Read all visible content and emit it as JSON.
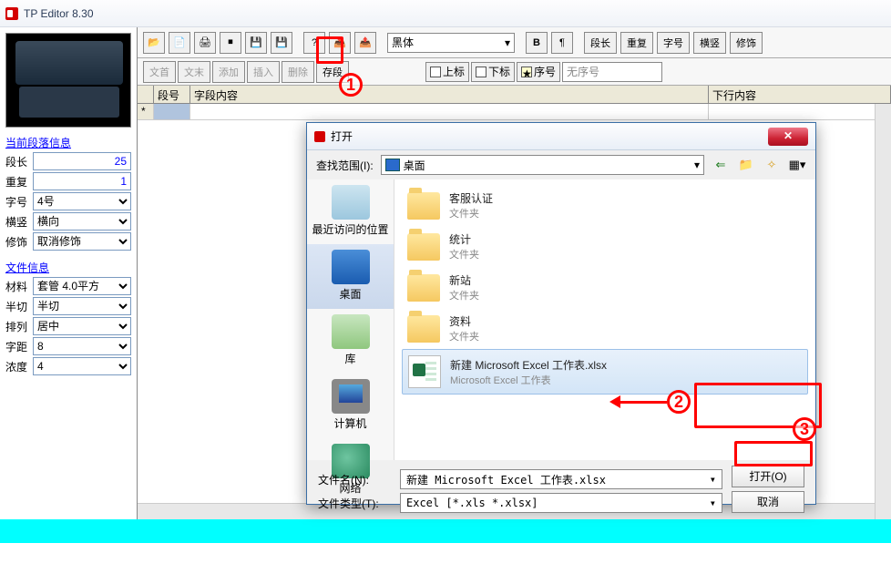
{
  "app": {
    "title": "TP Editor  8.30"
  },
  "left": {
    "section1": "当前段落信息",
    "duanchang_lbl": "段长",
    "duanchang_val": "25",
    "chongfu_lbl": "重复",
    "chongfu_val": "1",
    "zihao_lbl": "字号",
    "zihao_val": "4号",
    "hengshu_lbl": "横竖",
    "hengshu_val": "横向",
    "xiushi_lbl": "修饰",
    "xiushi_val": "取消修饰",
    "section2": "文件信息",
    "cailiao_lbl": "材料",
    "cailiao_val": "套管 4.0平方",
    "banqie_lbl": "半切",
    "banqie_val": "半切",
    "pailie_lbl": "排列",
    "pailie_val": "居中",
    "ziju_lbl": "字距",
    "ziju_val": "8",
    "nongdu_lbl": "浓度",
    "nongdu_val": "4"
  },
  "toolbar": {
    "font": "黑体",
    "btns2": [
      "文首",
      "文末",
      "添加",
      "插入",
      "删除",
      "存段"
    ],
    "btns_right": [
      "段长",
      "重复",
      "字号",
      "横竖",
      "修饰"
    ],
    "sup": "上标",
    "sub": "下标",
    "seq": "序号",
    "noindex": "无序号"
  },
  "grid": {
    "col1": "段号",
    "col2": "字段内容",
    "col3": "下行内容",
    "row_marker": "*"
  },
  "dialog": {
    "title": "打开",
    "look_lbl": "查找范围(I):",
    "look_val": "桌面",
    "places": {
      "recent": "最近访问的位置",
      "desktop": "桌面",
      "library": "库",
      "computer": "计算机",
      "network": "网络"
    },
    "folders": [
      {
        "name": "客服认证",
        "type": "文件夹"
      },
      {
        "name": "统计",
        "type": "文件夹"
      },
      {
        "name": "新站",
        "type": "文件夹"
      },
      {
        "name": "资料",
        "type": "文件夹"
      }
    ],
    "selected": {
      "name": "新建 Microsoft Excel 工作表.xlsx",
      "type": "Microsoft Excel 工作表"
    },
    "filename_lbl": "文件名(N):",
    "filename_val": "新建 Microsoft Excel 工作表.xlsx",
    "filetype_lbl": "文件类型(T):",
    "filetype_val": "Excel  [*.xls *.xlsx]",
    "open_btn": "打开(O)",
    "cancel_btn": "取消"
  },
  "annotations": {
    "a1": "1",
    "a2": "2",
    "a3": "3"
  }
}
